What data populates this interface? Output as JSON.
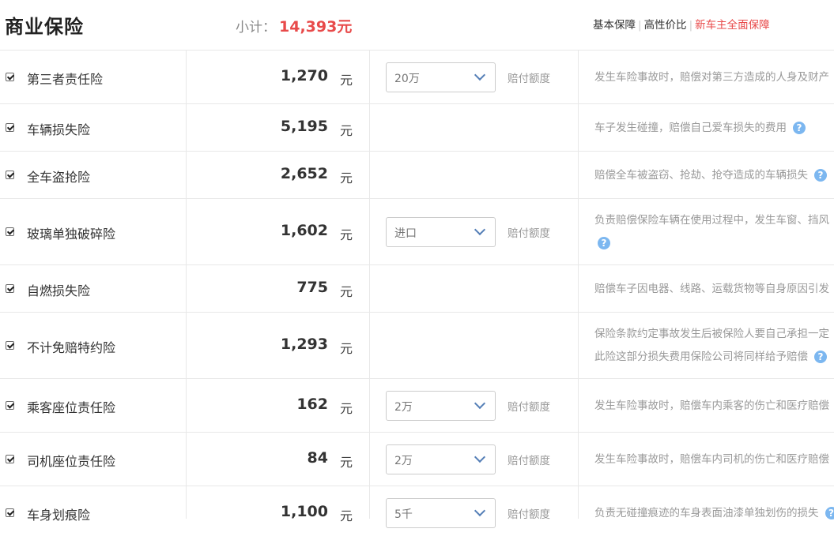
{
  "header": {
    "title": "商业保险",
    "subtotal_label": "小计：",
    "subtotal_value": "14,393元",
    "plans": [
      "基本保障",
      "高性价比",
      "新车主全面保障"
    ]
  },
  "unit": "元",
  "amount_label": "赔付额度",
  "help_icon": "?",
  "colors": {
    "accent_red": "#e84a4a",
    "help_blue": "#7cb7f0",
    "chevron_blue": "#557fb7"
  },
  "rows": [
    {
      "checked": true,
      "name": "第三者责任险",
      "price": "1,270",
      "select": "20万",
      "desc": [
        "发生车险事故时，赔偿对第三方造成的人身及财产"
      ]
    },
    {
      "checked": true,
      "name": "车辆损失险",
      "price": "5,195",
      "desc": [
        "车子发生碰撞，赔偿自己爱车损失的费用"
      ]
    },
    {
      "checked": true,
      "name": "全车盗抢险",
      "price": "2,652",
      "desc": [
        "赔偿全车被盗窃、抢劫、抢夺造成的车辆损失"
      ]
    },
    {
      "checked": true,
      "name": "玻璃单独破碎险",
      "price": "1,602",
      "select": "进口",
      "desc": [
        "负责赔偿保险车辆在使用过程中，发生车窗、挡风",
        ""
      ]
    },
    {
      "checked": true,
      "name": "自燃损失险",
      "price": "775",
      "desc": [
        "赔偿车子因电器、线路、运载货物等自身原因引发"
      ]
    },
    {
      "checked": true,
      "name": "不计免赔特约险",
      "price": "1,293",
      "desc": [
        "保险条款约定事故发生后被保险人要自己承担一定",
        "此险这部分损失费用保险公司将同样给予赔偿"
      ]
    },
    {
      "checked": true,
      "name": "乘客座位责任险",
      "price": "162",
      "select": "2万",
      "desc": [
        "发生车险事故时，赔偿车内乘客的伤亡和医疗赔偿"
      ]
    },
    {
      "checked": true,
      "name": "司机座位责任险",
      "price": "84",
      "select": "2万",
      "desc": [
        "发生车险事故时，赔偿车内司机的伤亡和医疗赔偿"
      ]
    },
    {
      "checked": true,
      "name": "车身划痕险",
      "price": "1,100",
      "select": "5千",
      "desc": [
        "负责无碰撞痕迹的车身表面油漆单独划伤的损失"
      ]
    }
  ]
}
